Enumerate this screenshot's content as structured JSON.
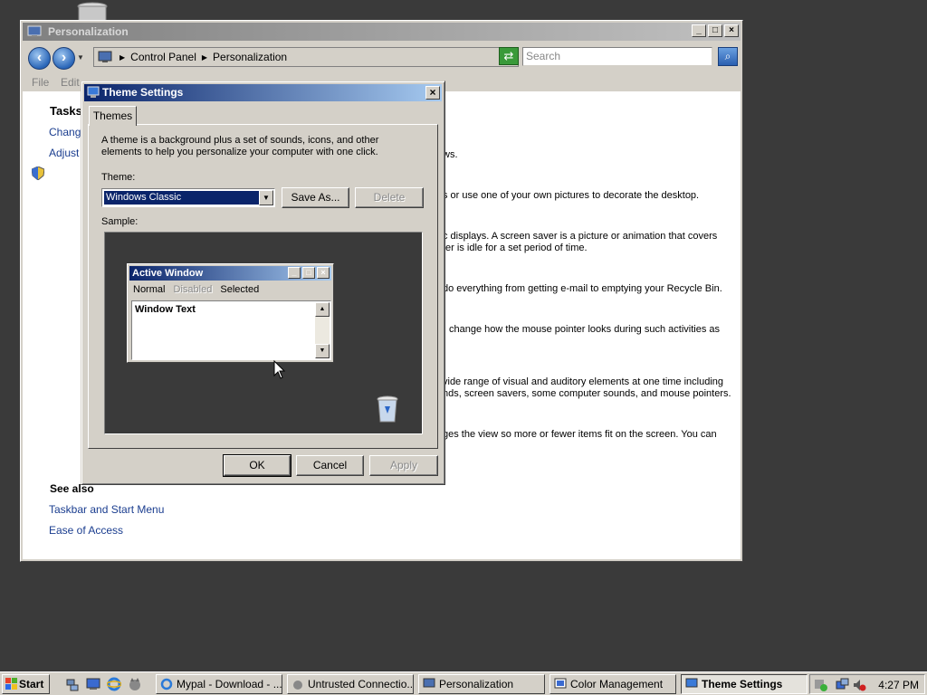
{
  "personalization_window": {
    "title": "Personalization",
    "address": {
      "crumbs": [
        "Control Panel",
        "Personalization"
      ]
    },
    "search_placeholder": "Search",
    "menu": [
      "File",
      "Edit"
    ],
    "tasks_heading": "Tasks",
    "task_links": [
      "Change",
      "Adjust"
    ],
    "content_fragments": [
      "ws.",
      "s or use one of your own pictures to decorate the desktop.",
      "c displays. A screen saver is a picture or animation that covers",
      "ter is idle for a set period of time.",
      "do everything from getting e-mail to emptying your Recycle Bin.",
      "change how the mouse pointer looks during such activities as",
      "vide range of visual and auditory elements at one time including",
      "nds, screen savers, some computer sounds, and mouse pointers.",
      "ges the view so more or fewer items fit on the screen. You can"
    ],
    "see_also": {
      "heading": "See also",
      "links": [
        "Taskbar and Start Menu",
        "Ease of Access"
      ]
    }
  },
  "theme_dialog": {
    "title": "Theme Settings",
    "tab": "Themes",
    "description": "A theme is a background plus a set of sounds, icons, and other elements to help you personalize your computer with one click.",
    "theme_label": "Theme:",
    "theme_value": "Windows Classic",
    "save_as": "Save As...",
    "delete": "Delete",
    "sample_label": "Sample:",
    "sample": {
      "active_title": "Active Window",
      "menu": {
        "normal": "Normal",
        "disabled": "Disabled",
        "selected": "Selected"
      },
      "window_text": "Window Text"
    },
    "ok": "OK",
    "cancel": "Cancel",
    "apply": "Apply"
  },
  "taskbar": {
    "start": "Start",
    "tasks": [
      {
        "label": "Mypal - Download - ...",
        "active": false
      },
      {
        "label": "Untrusted Connectio...",
        "active": false
      },
      {
        "label": "Personalization",
        "active": false
      },
      {
        "label": "Color Management",
        "active": false
      },
      {
        "label": "Theme Settings",
        "active": true
      }
    ],
    "clock": "4:27 PM"
  },
  "colors": {
    "desktop": "#3a3a3a",
    "active_title_start": "#0a246a",
    "active_title_end": "#a6caf0",
    "link": "#1a3d8f"
  }
}
